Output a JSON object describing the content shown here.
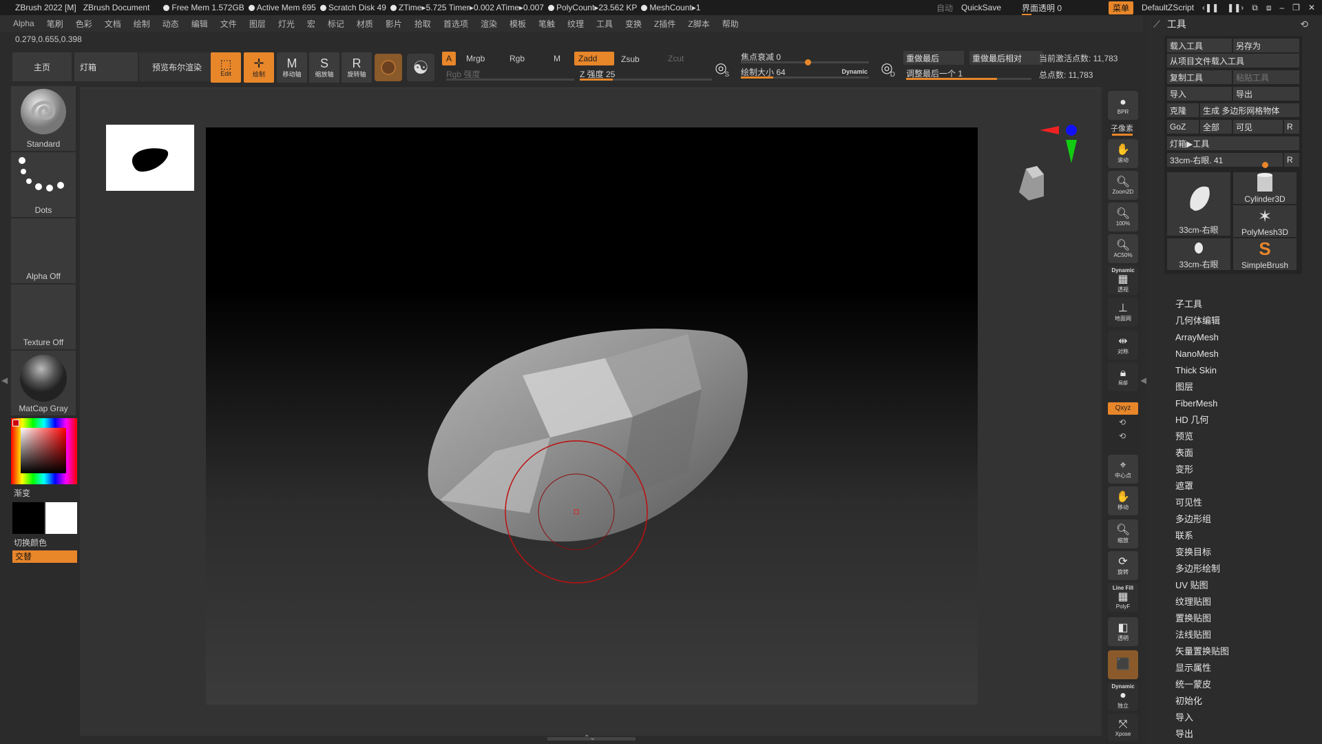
{
  "titlebar": {
    "app": "ZBrush 2022 [M]",
    "doc": "ZBrush Document",
    "free_mem": "Free Mem 1.572GB",
    "active_mem": "Active Mem 695",
    "scratch": "Scratch Disk 49",
    "ztime": "ZTime▸5.725 Timer▸0.002 ATime▸0.007",
    "polycount": "PolyCount▸23.562 KP",
    "meshcount": "MeshCount▸1",
    "auto": "自动",
    "quicksave": "QuickSave",
    "ui_trans_label": "界面透明 0",
    "ui_trans_value": 0.15,
    "menu_btn": "菜单",
    "zscript": "DefaultZScript"
  },
  "menubar": [
    "Alpha",
    "笔刷",
    "色彩",
    "文档",
    "绘制",
    "动态",
    "编辑",
    "文件",
    "图层",
    "灯光",
    "宏",
    "标记",
    "材质",
    "影片",
    "拾取",
    "首选项",
    "渲染",
    "模板",
    "笔触",
    "纹理",
    "工具",
    "变换",
    "Z插件",
    "Z脚本",
    "帮助"
  ],
  "coords": "0.279,0.655,0.398",
  "toolbar": {
    "home": "主页",
    "lightbox": "灯箱",
    "bpr_preview": "预览布尔渲染",
    "edit": "Edit",
    "draw": "绘制",
    "move": "移动轴",
    "scale": "缩放轴",
    "rotate": "旋转轴",
    "a": "A",
    "mrgb": "Mrgb",
    "rgb": "Rgb",
    "m": "M",
    "rgb_intensity": "Rgb 强度",
    "zadd": "Zadd",
    "zsub": "Zsub",
    "zcut": "Zcut",
    "z_intensity": "Z 强度 25",
    "z_intensity_value": 0.25,
    "focal": "焦点衰减 0",
    "focal_value": 0.5,
    "draw_size": "绘制大小 64",
    "draw_size_value": 0.25,
    "dynamic": "Dynamic",
    "s_label": "S",
    "d_label": "D",
    "redo_last": "重做最后",
    "redo_last_rel": "重做最后相对",
    "adjust_last": "调整最后一个 1",
    "active_points": "当前激活点数: 11,783",
    "total_points": "总点数: 11,783"
  },
  "leftshelf": {
    "brush": "Standard",
    "stroke": "Dots",
    "alpha": "Alpha Off",
    "texture": "Texture Off",
    "material": "MatCap Gray",
    "gradient": "渐变",
    "switch_color": "切换颜色",
    "alternate": "交替"
  },
  "rightshelf": {
    "bpr": "BPR",
    "subpixel": "子像素",
    "scroll": "滚动",
    "zoom2d": "Zoom2D",
    "p100": "100%",
    "ac50": "AC50%",
    "dynamic": "Dynamic",
    "persp": "透视",
    "floor": "地面网",
    "sym": "对称",
    "local": "局部",
    "xyz": "Qxyz",
    "frame": "中心点",
    "move": "移动",
    "scale": "缩放",
    "rotate": "旋转",
    "linefill": "Line Fill",
    "polyf": "PolyF",
    "transp": "透明",
    "solo": "独立",
    "xpose": "Xpose"
  },
  "toolpanel": {
    "title": "工具",
    "load": "载入工具",
    "saveas": "另存为",
    "load_project": "从项目文件载入工具",
    "copy": "复制工具",
    "paste": "粘贴工具",
    "import": "导入",
    "export": "导出",
    "clone": "克隆",
    "make_polymesh": "生成 多边形网格物体",
    "goz": "GoZ",
    "all": "全部",
    "visible": "可见",
    "r": "R",
    "lightbox_tools": "灯箱▶工具",
    "current_tool": "33cm-右眼. 41",
    "current_tool_value": 0.82,
    "thumb1": "33cm-右眼",
    "thumb2": "Cylinder3D",
    "thumb3": "PolyMesh3D",
    "thumb4": "33cm-右眼",
    "thumb5": "SimpleBrush",
    "sections": [
      "子工具",
      "几何体编辑",
      "ArrayMesh",
      "NanoMesh",
      "Thick Skin",
      "图层",
      "FiberMesh",
      "HD 几何",
      "预览",
      "表面",
      "变形",
      "遮罩",
      "可见性",
      "多边形组",
      "联系",
      "变换目标",
      "多边形绘制",
      "UV 贴图",
      "纹理贴图",
      "置换贴图",
      "法线贴图",
      "矢量置换贴图",
      "显示属性",
      "统一蒙皮",
      "初始化",
      "导入",
      "导出"
    ]
  },
  "colors": {
    "accent": "#e8862a",
    "bg": "#2b2b2b"
  }
}
